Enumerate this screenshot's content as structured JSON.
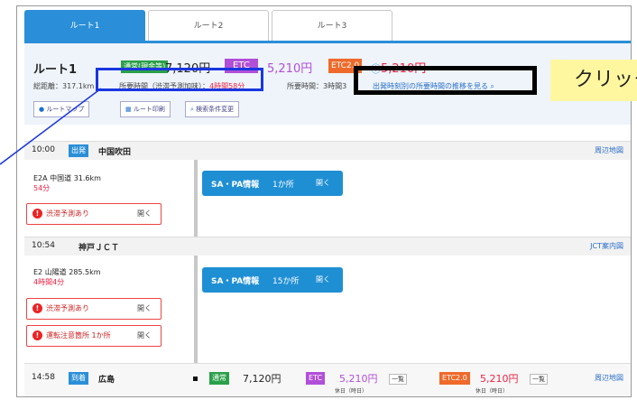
{
  "tabs": [
    {
      "label": "ルート1",
      "active": true
    },
    {
      "label": "ルート2",
      "active": false
    },
    {
      "label": "ルート3",
      "active": false
    }
  ],
  "summary": {
    "route_name": "ルート1",
    "normal_badge": "通常(現金等)",
    "normal_price": "7,120円",
    "etc_badge": "ETC",
    "etc_price": "5,210円",
    "etc2_badge": "ETC2.0",
    "etc2_price": "5,210円",
    "distance": "総距離：317.1km",
    "time_label": "所要時間（渋滞予測加味）：",
    "time_value": "4時間58分",
    "time2": "所要時間：3時間3",
    "transition_link": "出発時刻別の所要時間の推移を見る",
    "btn_map": "ルートマップ",
    "btn_print": "ルート印刷",
    "btn_search": "検索条件変更"
  },
  "callout": {
    "text": "クリック"
  },
  "colors": {
    "accent": "#2a8fd8",
    "blue_box": "#1a36e0",
    "warning": "#e44",
    "callout_bg": "#fff7a0"
  },
  "segments": {
    "start": {
      "time": "10:00",
      "badge": "出発",
      "place": "中国吹田",
      "link": "周辺地図"
    },
    "road1": {
      "road": "E2A 中国道 31.6km",
      "dur": "54分"
    },
    "warn1": {
      "text": "渋滞予測あり",
      "link": "開く"
    },
    "sa1": {
      "title": "SA・PA情報",
      "count": "1か所",
      "open": "開く"
    },
    "jct": {
      "time": "10:54",
      "place": "神戸ＪＣＴ",
      "link": "JCT案内図"
    },
    "road2": {
      "road": "E2 山陽道 285.5km",
      "dur": "4時間4分"
    },
    "warn2": {
      "text": "渋滞予測あり",
      "link": "開く"
    },
    "warn3": {
      "text": "運転注意箇所",
      "count": "1か所",
      "link": "開く"
    },
    "sa2": {
      "title": "SA・PA情報",
      "count": "15か所",
      "open": "開く"
    },
    "end": {
      "time": "14:58",
      "badge": "到着",
      "place": "広島",
      "normal_badge": "通常",
      "normal_price": "7,120円",
      "etc_badge": "ETC",
      "etc_price": "5,210円",
      "etc_list": "一覧",
      "etc_sub": "休日（時日）",
      "etc2_badge": "ETC2.0",
      "etc2_price": "5,210円",
      "etc2_list": "一覧",
      "etc2_sub": "休日（時日）",
      "link": "周辺地図"
    }
  }
}
